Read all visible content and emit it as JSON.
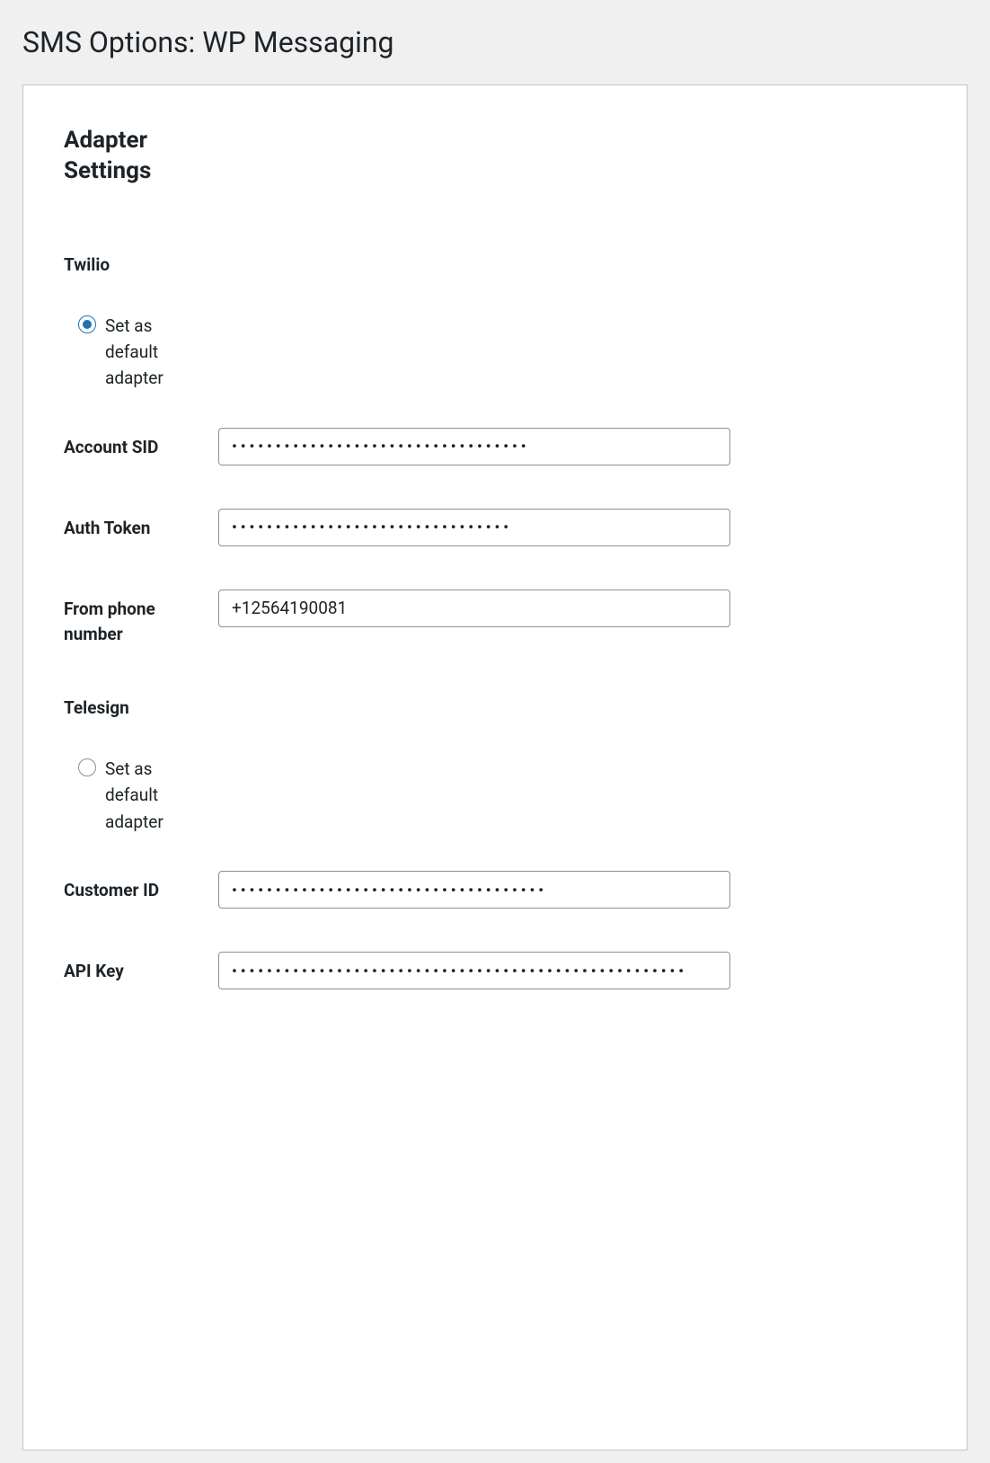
{
  "page": {
    "title": "SMS Options: WP Messaging"
  },
  "section": {
    "heading": "Adapter Settings"
  },
  "adapters": {
    "twilio": {
      "name": "Twilio",
      "default_label": "Set as default adapter",
      "is_default": true,
      "fields": {
        "account_sid": {
          "label": "Account SID",
          "value": "••••••••••••••••••••••••••••••••••"
        },
        "auth_token": {
          "label": "Auth Token",
          "value": "••••••••••••••••••••••••••••••••"
        },
        "from_phone": {
          "label": "From phone number",
          "value": "+12564190081"
        }
      }
    },
    "telesign": {
      "name": "Telesign",
      "default_label": "Set as default adapter",
      "is_default": false,
      "fields": {
        "customer_id": {
          "label": "Customer ID",
          "value": "••••••••••••••••••••••••••••••••••••"
        },
        "api_key": {
          "label": "API Key",
          "value": "••••••••••••••••••••••••••••••••••••••••••••••••••••"
        }
      }
    }
  }
}
